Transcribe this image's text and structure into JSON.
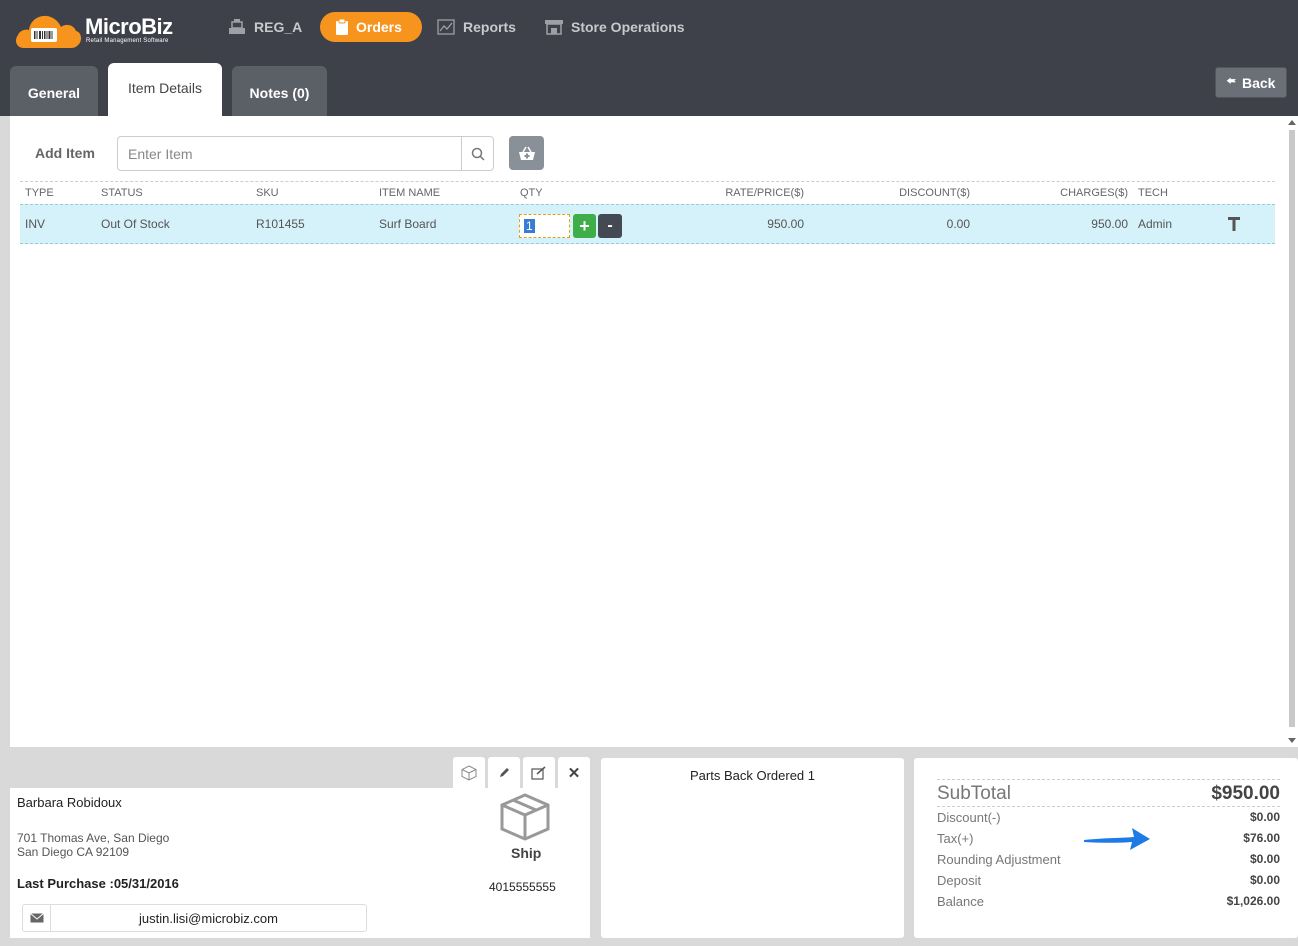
{
  "app": {
    "logo_text": "MicroBiz",
    "logo_sub": "Retail Management Software"
  },
  "nav": {
    "reg": "REG_A",
    "orders": "Orders",
    "reports": "Reports",
    "store": "Store Operations"
  },
  "tabs": {
    "general": "General",
    "item_details": "Item Details",
    "notes": "Notes (0)"
  },
  "back_label": "Back",
  "add_item": {
    "label": "Add Item",
    "placeholder": "Enter Item"
  },
  "columns": {
    "type": "TYPE",
    "status": "STATUS",
    "sku": "SKU",
    "item_name": "ITEM NAME",
    "qty": "QTY",
    "rate": "RATE/PRICE($)",
    "discount": "DISCOUNT($)",
    "charges": "CHARGES($)",
    "tech": "TECH"
  },
  "rows": [
    {
      "type": "INV",
      "status": "Out Of Stock",
      "sku": "R101455",
      "item_name": "Surf Board",
      "qty": "1",
      "rate": "950.00",
      "discount": "0.00",
      "charges": "950.00",
      "tech": "Admin"
    }
  ],
  "customer": {
    "name": "Barbara Robidoux",
    "address1": "701 Thomas Ave, San Diego",
    "address2": "San Diego CA 92109",
    "last_purchase": "Last Purchase :05/31/2016",
    "ship_label": "Ship",
    "phone": "4015555555",
    "email": "justin.lisi@microbiz.com"
  },
  "parts_back_ordered": "Parts Back Ordered 1",
  "totals": {
    "subtotal_label": "SubTotal",
    "subtotal": "$950.00",
    "discount_label": "Discount(-)",
    "discount": "$0.00",
    "tax_label": "Tax(+)",
    "tax": "$76.00",
    "rounding_label": "Rounding Adjustment",
    "rounding": "$0.00",
    "deposit_label": "Deposit",
    "deposit": "$0.00",
    "balance_label": "Balance",
    "balance": "$1,026.00"
  },
  "colors": {
    "topbar": "#3e4149",
    "accent": "#f7941d",
    "row_highlight": "#d5f1fa",
    "plus_green": "#3fae49",
    "arrow_blue": "#1e7be6"
  }
}
